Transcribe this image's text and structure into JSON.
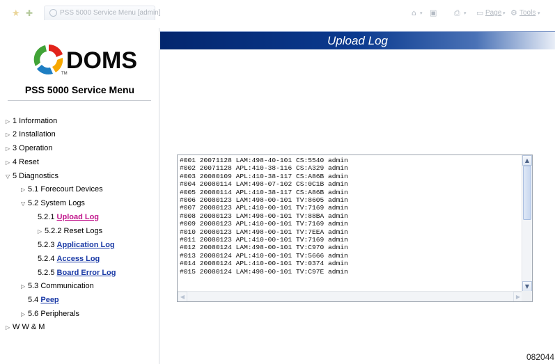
{
  "browser": {
    "tab_title": "PSS 5000 Service Menu [admin]",
    "toolbar": {
      "page_label": "Page",
      "tools_label": "Tools",
      "icons": [
        "favorites-star-icon",
        "add-favorites-icon",
        "home-icon",
        "feeds-icon",
        "print-icon",
        "page-icon",
        "tools-gear-icon"
      ]
    }
  },
  "sidebar": {
    "logo_text": "DOMS",
    "logo_tm": "TM",
    "menu_title": "PSS 5000 Service Menu",
    "items": [
      {
        "label": "1 Information"
      },
      {
        "label": "2 Installation"
      },
      {
        "label": "3 Operation"
      },
      {
        "label": "4 Reset"
      },
      {
        "label": "5 Diagnostics"
      },
      {
        "label": "5.1 Forecourt Devices"
      },
      {
        "label": "5.2 System Logs"
      },
      {
        "prefix": "5.2.1",
        "link": "Upload Log"
      },
      {
        "label": "5.2.2 Reset Logs"
      },
      {
        "prefix": "5.2.3",
        "link": "Application Log"
      },
      {
        "prefix": "5.2.4",
        "link": "Access Log"
      },
      {
        "prefix": "5.2.5",
        "link": "Board Error Log"
      },
      {
        "label": "5.3 Communication"
      },
      {
        "prefix": "5.4",
        "link": "Peep"
      },
      {
        "label": "5.6 Peripherals"
      },
      {
        "label": "W W & M"
      }
    ]
  },
  "main": {
    "title": "Upload Log",
    "log_lines": [
      "#001 20071128 LAM:498-40-101 CS:5540 admin",
      "#002 20071128 APL:410-38-116 CS:A329 admin",
      "#003 20080109 APL:410-38-117 CS:A86B admin",
      "#004 20080114 LAM:498-07-102 CS:0C1B admin",
      "#005 20080114 APL:410-38-117 CS:A86B admin",
      "#006 20080123 LAM:498-00-101 TV:8605 admin",
      "#007 20080123 APL:410-00-101 TV:7169 admin",
      "#008 20080123 LAM:498-00-101 TV:88BA admin",
      "#009 20080123 APL:410-00-101 TV:7169 admin",
      "#010 20080123 LAM:498-00-101 TV:7EEA admin",
      "#011 20080123 APL:410-00-101 TV:7169 admin",
      "#012 20080124 LAM:498-00-101 TV:C970 admin",
      "#013 20080124 APL:410-00-101 TV:5666 admin",
      "#014 20080124 APL:410-00-101 TV:0374 admin",
      "#015 20080124 LAM:498-00-101 TV:C97E admin"
    ]
  },
  "figure_id": "082044",
  "colors": {
    "banner_dark": "#03266e",
    "link": "#1a3aa6",
    "active_link": "#c0138a"
  }
}
